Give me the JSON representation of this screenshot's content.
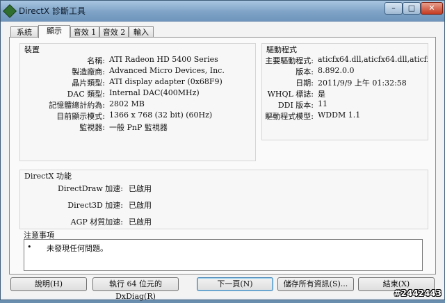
{
  "window": {
    "title": "DirectX 診斷工具",
    "controls": {
      "minimize": "–",
      "maximize": "□",
      "close": "✕"
    }
  },
  "tabs": [
    {
      "label": "系統",
      "active": false
    },
    {
      "label": "顯示",
      "active": true
    },
    {
      "label": "音效 1",
      "active": false
    },
    {
      "label": "音效 2",
      "active": false
    },
    {
      "label": "輸入",
      "active": false
    }
  ],
  "device": {
    "title": "裝置",
    "rows": [
      {
        "label": "名稱:",
        "value": "ATI Radeon HD 5400 Series"
      },
      {
        "label": "製造廠商:",
        "value": "Advanced Micro Devices, Inc."
      },
      {
        "label": "晶片類型:",
        "value": "ATI display adapter (0x68F9)"
      },
      {
        "label": "DAC 類型:",
        "value": "Internal DAC(400MHz)"
      },
      {
        "label": "記憶體總計約為:",
        "value": "2802 MB"
      },
      {
        "label": "目前顯示模式:",
        "value": "1366 x 768 (32 bit) (60Hz)"
      },
      {
        "label": "監視器:",
        "value": "一般 PnP 監視器"
      }
    ]
  },
  "driver": {
    "title": "驅動程式",
    "rows": [
      {
        "label": "主要驅動程式:",
        "value": "aticfx64.dll,aticfx64.dll,aticfx64.dll,at"
      },
      {
        "label": "版本:",
        "value": "8.892.0.0"
      },
      {
        "label": "日期:",
        "value": "2011/9/9 上午 01:32:58"
      },
      {
        "label": "WHQL 標誌:",
        "value": "是"
      },
      {
        "label": "DDI 版本:",
        "value": "11"
      },
      {
        "label": "驅動程式模型:",
        "value": "WDDM 1.1"
      }
    ]
  },
  "features": {
    "title": "DirectX 功能",
    "rows": [
      {
        "label": "DirectDraw 加速:",
        "value": "已啟用"
      },
      {
        "label": "Direct3D 加速:",
        "value": "已啟用"
      },
      {
        "label": "AGP 材質加速:",
        "value": "已啟用"
      }
    ]
  },
  "notes": {
    "title": "注意事項",
    "bullet": "•",
    "text": "未發現任何問題。"
  },
  "buttons": {
    "help": "說明(H)",
    "run64": "執行 64 位元的 DxDiag(R)",
    "next": "下一頁(N)",
    "save": "儲存所有資訊(S)...",
    "exit": "結束(X)"
  },
  "watermark": "#2442443"
}
